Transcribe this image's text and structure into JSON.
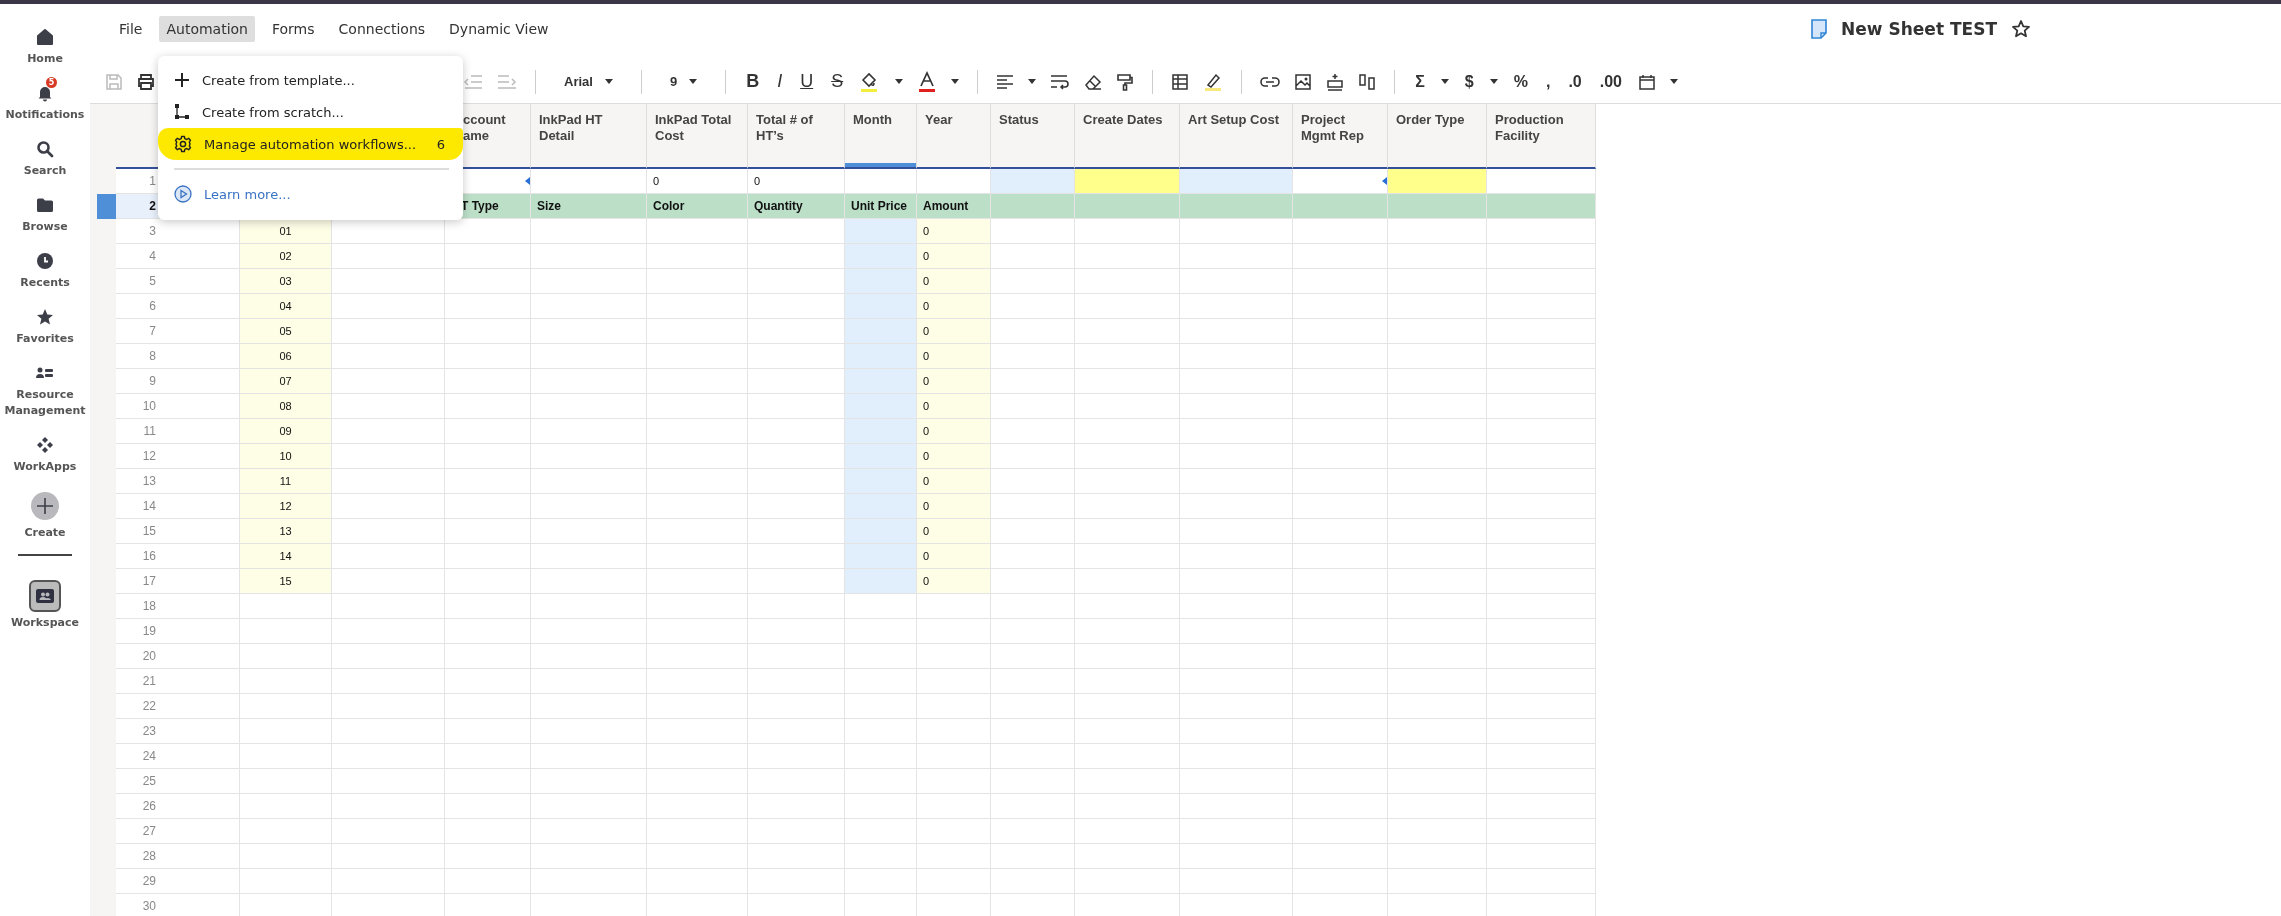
{
  "sidebar": {
    "items": [
      {
        "label": "Home",
        "selected": false
      },
      {
        "label": "Notifications",
        "selected": false,
        "badge": "5"
      },
      {
        "label": "Search",
        "selected": false
      },
      {
        "label": "Browse",
        "selected": false
      },
      {
        "label": "Recents",
        "selected": false
      },
      {
        "label": "Favorites",
        "selected": false
      },
      {
        "label": "Resource Management",
        "selected": false
      },
      {
        "label": "WorkApps",
        "selected": false
      },
      {
        "label": "Create",
        "selected": false
      }
    ],
    "workspace": {
      "label": "Workspace",
      "selected": false
    }
  },
  "menu_bar": [
    {
      "label": "File",
      "selected": false
    },
    {
      "label": "Automation",
      "selected": true
    },
    {
      "label": "Forms",
      "selected": false
    },
    {
      "label": "Connections",
      "selected": false
    },
    {
      "label": "Dynamic View",
      "selected": false
    }
  ],
  "automation_menu": {
    "items": [
      {
        "kind": "action",
        "label": "Create from template...",
        "highlighted": false
      },
      {
        "kind": "action",
        "label": "Create from scratch...",
        "highlighted": false
      },
      {
        "kind": "action",
        "label": "Manage automation workflows...",
        "count": "6",
        "highlighted": true
      },
      {
        "kind": "link",
        "label": "Learn more...",
        "highlighted": false
      }
    ]
  },
  "toolbar": {
    "font": "Arial",
    "size": "9",
    "text_styles": [
      "B",
      "I",
      "U",
      "S"
    ],
    "number_formats": [
      "Σ",
      "$",
      "%",
      ",",
      ".0",
      ".00"
    ]
  },
  "sheet": {
    "title": "New Sheet TEST",
    "favorite": false
  },
  "grid": {
    "columns": [
      {
        "kind": "item_tint",
        "color": "#fefde6"
      },
      {
        "kind": "plain"
      },
      {
        "kind": "plain",
        "header": "ccount\name",
        "selected": false,
        "flag": true
      },
      {
        "kind": "plain",
        "header": "InkPad HT Detail",
        "selected": false
      },
      {
        "kind": "plain",
        "header": "InkPad Total Cost",
        "selected": false
      },
      {
        "kind": "plain",
        "header": "Total # of HT’s",
        "selected": false
      },
      {
        "kind": "item_tint",
        "header": "Month",
        "selected": true,
        "color": "#e1eefb"
      },
      {
        "kind": "item_tint",
        "header": "Year",
        "selected": false,
        "color": "#fefde6"
      },
      {
        "kind": "top_tint",
        "header": "Status",
        "selected": false,
        "color": "#e1eefb"
      },
      {
        "kind": "top_tint",
        "header": "Create Dates",
        "selected": false,
        "color": "#ffff8c"
      },
      {
        "kind": "top_tint",
        "header": "Art Setup Cost",
        "selected": false,
        "color": "#e1eefb"
      },
      {
        "kind": "plain",
        "header": "Project Mgmt Rep",
        "selected": false,
        "flag": true
      },
      {
        "kind": "top_tint",
        "header": "Order Type",
        "selected": false,
        "color": "#ffff8c"
      },
      {
        "kind": "plain",
        "header": "Production Facility",
        "selected": false
      }
    ],
    "rows": [
      {
        "number": "1",
        "selected": false,
        "kind": "title",
        "cells": [
          null,
          null,
          null,
          null,
          "0",
          "0",
          null,
          null,
          null,
          null,
          null,
          null,
          null,
          null
        ]
      },
      {
        "number": "2",
        "selected": true,
        "kind": "header",
        "cells": [
          null,
          null,
          "T Type",
          "Size",
          "Color",
          "Quantity",
          "Unit Price",
          "Amount",
          null,
          null,
          null,
          null,
          null,
          null
        ]
      },
      {
        "number": "3",
        "selected": false,
        "kind": "item",
        "cells": [
          "01",
          null,
          null,
          null,
          null,
          null,
          null,
          "0",
          null,
          null,
          null,
          null,
          null,
          null
        ]
      },
      {
        "number": "4",
        "selected": false,
        "kind": "item",
        "cells": [
          "02",
          null,
          null,
          null,
          null,
          null,
          null,
          "0",
          null,
          null,
          null,
          null,
          null,
          null
        ]
      },
      {
        "number": "5",
        "selected": false,
        "kind": "item",
        "cells": [
          "03",
          null,
          null,
          null,
          null,
          null,
          null,
          "0",
          null,
          null,
          null,
          null,
          null,
          null
        ]
      },
      {
        "number": "6",
        "selected": false,
        "kind": "item",
        "cells": [
          "04",
          null,
          null,
          null,
          null,
          null,
          null,
          "0",
          null,
          null,
          null,
          null,
          null,
          null
        ]
      },
      {
        "number": "7",
        "selected": false,
        "kind": "item",
        "cells": [
          "05",
          null,
          null,
          null,
          null,
          null,
          null,
          "0",
          null,
          null,
          null,
          null,
          null,
          null
        ]
      },
      {
        "number": "8",
        "selected": false,
        "kind": "item",
        "cells": [
          "06",
          null,
          null,
          null,
          null,
          null,
          null,
          "0",
          null,
          null,
          null,
          null,
          null,
          null
        ]
      },
      {
        "number": "9",
        "selected": false,
        "kind": "item",
        "cells": [
          "07",
          null,
          null,
          null,
          null,
          null,
          null,
          "0",
          null,
          null,
          null,
          null,
          null,
          null
        ]
      },
      {
        "number": "10",
        "selected": false,
        "kind": "item",
        "cells": [
          "08",
          null,
          null,
          null,
          null,
          null,
          null,
          "0",
          null,
          null,
          null,
          null,
          null,
          null
        ]
      },
      {
        "number": "11",
        "selected": false,
        "kind": "item",
        "cells": [
          "09",
          null,
          null,
          null,
          null,
          null,
          null,
          "0",
          null,
          null,
          null,
          null,
          null,
          null
        ]
      },
      {
        "number": "12",
        "selected": false,
        "kind": "item",
        "cells": [
          "10",
          null,
          null,
          null,
          null,
          null,
          null,
          "0",
          null,
          null,
          null,
          null,
          null,
          null
        ]
      },
      {
        "number": "13",
        "selected": false,
        "kind": "item",
        "cells": [
          "11",
          null,
          null,
          null,
          null,
          null,
          null,
          "0",
          null,
          null,
          null,
          null,
          null,
          null
        ]
      },
      {
        "number": "14",
        "selected": false,
        "kind": "item",
        "cells": [
          "12",
          null,
          null,
          null,
          null,
          null,
          null,
          "0",
          null,
          null,
          null,
          null,
          null,
          null
        ]
      },
      {
        "number": "15",
        "selected": false,
        "kind": "item",
        "cells": [
          "13",
          null,
          null,
          null,
          null,
          null,
          null,
          "0",
          null,
          null,
          null,
          null,
          null,
          null
        ]
      },
      {
        "number": "16",
        "selected": false,
        "kind": "item",
        "cells": [
          "14",
          null,
          null,
          null,
          null,
          null,
          null,
          "0",
          null,
          null,
          null,
          null,
          null,
          null
        ]
      },
      {
        "number": "17",
        "selected": false,
        "kind": "item",
        "cells": [
          "15",
          null,
          null,
          null,
          null,
          null,
          null,
          "0",
          null,
          null,
          null,
          null,
          null,
          null
        ]
      },
      {
        "number": "18",
        "selected": false,
        "kind": "blank"
      },
      {
        "number": "19",
        "selected": false,
        "kind": "blank"
      },
      {
        "number": "20",
        "selected": false,
        "kind": "blank"
      },
      {
        "number": "21",
        "selected": false,
        "kind": "blank"
      },
      {
        "number": "22",
        "selected": false,
        "kind": "blank"
      },
      {
        "number": "23",
        "selected": false,
        "kind": "blank"
      },
      {
        "number": "24",
        "selected": false,
        "kind": "blank"
      },
      {
        "number": "25",
        "selected": false,
        "kind": "blank"
      },
      {
        "number": "26",
        "selected": false,
        "kind": "blank"
      },
      {
        "number": "27",
        "selected": false,
        "kind": "blank"
      },
      {
        "number": "28",
        "selected": false,
        "kind": "blank"
      },
      {
        "number": "29",
        "selected": false,
        "kind": "blank"
      },
      {
        "number": "30",
        "selected": false,
        "kind": "blank"
      }
    ]
  }
}
